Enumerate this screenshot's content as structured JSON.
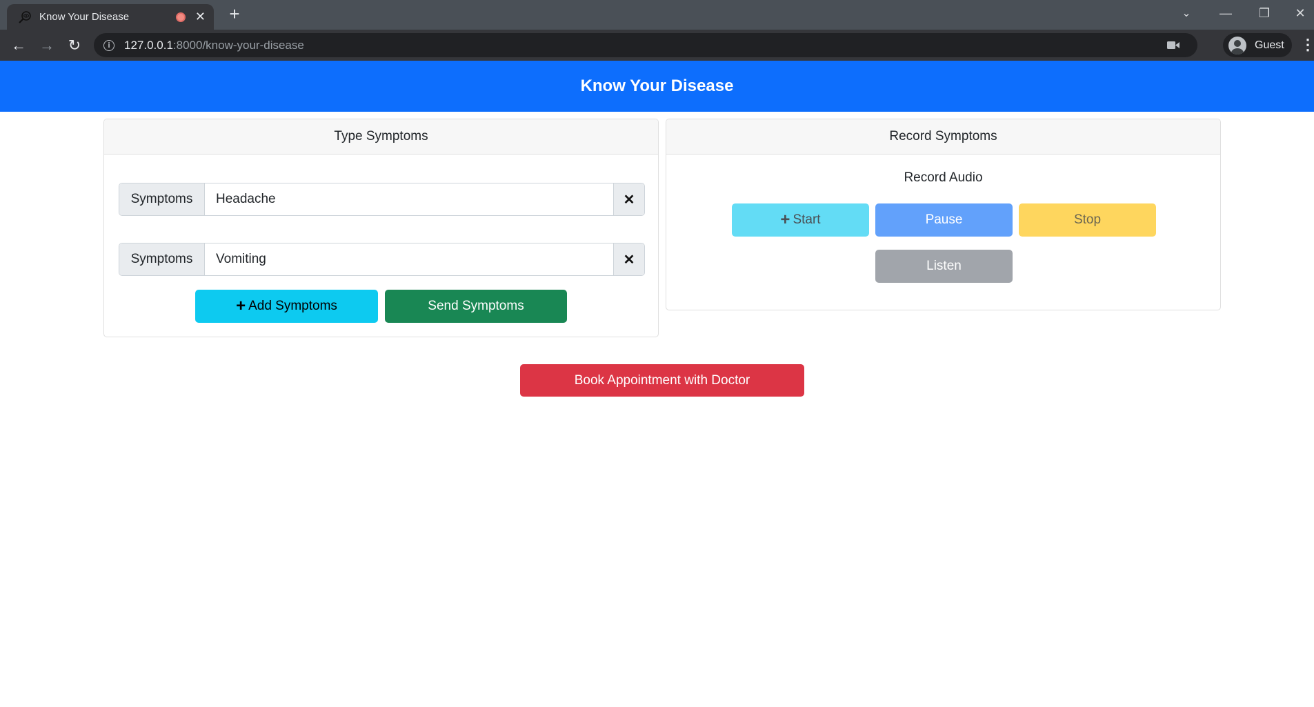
{
  "browser": {
    "tab_title": "Know Your Disease",
    "url_host": "127.0.0.1",
    "url_rest": ":8000/know-your-disease",
    "profile_label": "Guest",
    "icons": {
      "favicon": "magnifier-eye-icon",
      "recording": "recording-dot-icon",
      "tab_close": "close-icon",
      "new_tab": "plus-icon",
      "back": "arrow-left-icon",
      "forward": "arrow-right-icon",
      "reload": "reload-icon",
      "site_info": "info-icon",
      "camera": "camera-icon",
      "menu": "kebab-menu-icon"
    },
    "glyphs": {
      "tab_close": "✕",
      "new_tab": "+",
      "back": "←",
      "forward": "→",
      "reload": "↻",
      "info": "i",
      "tab_search": "⌄",
      "minimize": "—",
      "restore": "❐",
      "close_window": "✕",
      "menu": "⋮"
    }
  },
  "page": {
    "header_title": "Know Your Disease",
    "type_card": {
      "title": "Type Symptoms",
      "rows": [
        {
          "label": "Symptoms",
          "value": "Headache",
          "remove_glyph": "✕"
        },
        {
          "label": "Symptoms",
          "value": "Vomiting",
          "remove_glyph": "✕"
        }
      ],
      "add_button": {
        "icon": "+",
        "label": "Add Symptoms"
      },
      "send_button": {
        "label": "Send Symptoms"
      }
    },
    "record_card": {
      "title": "Record Symptoms",
      "subtitle": "Record Audio",
      "start_button": {
        "icon": "+",
        "label": "Start"
      },
      "pause_button": {
        "label": "Pause"
      },
      "stop_button": {
        "label": "Stop"
      },
      "listen_button": {
        "label": "Listen"
      }
    },
    "book_button": {
      "label": "Book Appointment with Doctor"
    }
  },
  "colors": {
    "primary": "#0d6efd",
    "info": "#0dcaf0",
    "success": "#198754",
    "danger": "#dc3545",
    "info_disabled": "#63dcf5",
    "primary_disabled": "#62a1fb",
    "warning_disabled": "#fed65e",
    "secondary_disabled": "#a1a5ab"
  }
}
